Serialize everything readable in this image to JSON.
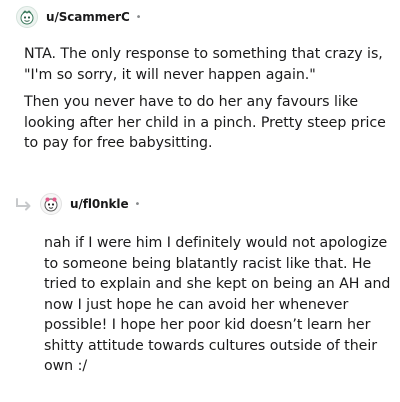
{
  "comments": [
    {
      "username": "u/ScammerC",
      "dot": "•",
      "paragraphs": [
        "NTA. The only response to something that crazy is,\n\"I'm so sorry, it will never happen again.\"",
        "Then you never have to do her any favours like\nlooking after her child in a pinch. Pretty steep price\nto pay for free babysitting."
      ]
    },
    {
      "username": "u/fl0nkle",
      "dot": "•",
      "paragraphs": [
        "nah if I were him I definitely would not apologize\nto someone being blatantly racist like that. He\ntried to explain and she kept on being an AH and\nnow I just hope he can avoid her whenever\npossible! I hope her poor kid doesn’t learn her\nshitty attitude towards cultures outside of their\nown :/"
      ]
    }
  ],
  "icons": {
    "reply_arrow": "reply-arrow-icon",
    "avatar": "snoo-avatar-icon"
  }
}
